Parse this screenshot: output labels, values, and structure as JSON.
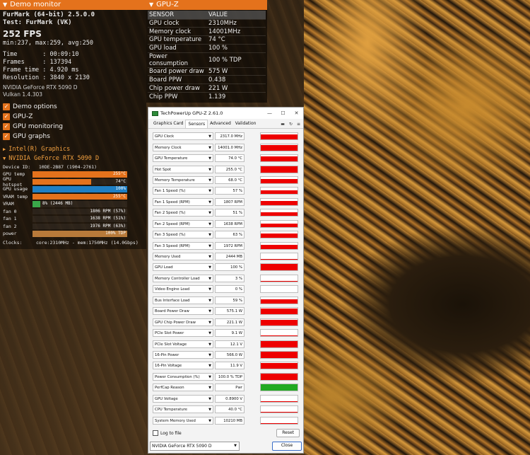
{
  "demo_monitor": {
    "header": "Demo monitor",
    "app": "FurMark (64-bit) 2.5.0.0",
    "test": "Test: FurMark (VK)",
    "fps": "252 FPS",
    "fps_stats": "min:237, max:259, avg:250",
    "time": "Time       : 00:09:10",
    "frames": "Frames     : 137394",
    "frame_time": "Frame time : 4.920 ms",
    "resolution": "Resolution : 3840 x 2130",
    "gpu_name": "NVIDIA GeForce RTX 5090 D",
    "vulkan": "Vulkan 1.4.303",
    "options": [
      "Demo options",
      "GPU-Z",
      "GPU monitoring",
      "GPU graphs"
    ],
    "sections": [
      "Intel(R) Graphics",
      "NVIDIA GeForce RTX 5090 D"
    ],
    "device_id": "Device ID:   10DE-2B87 (1904-2761)",
    "bars": [
      {
        "label": "GPU temp",
        "value": "255°C",
        "fill": 1.0,
        "color": "#e4721c"
      },
      {
        "label": "GPU hotspot",
        "value": "74°C",
        "fill": 0.62,
        "color": "#e4721c"
      },
      {
        "label": "GPU usage",
        "value": "100%",
        "fill": 1.0,
        "color": "#1f7fc4"
      },
      {
        "label": "VRAM temp",
        "value": "255°C",
        "fill": 1.0,
        "color": "#e4721c"
      },
      {
        "label": "VRAM",
        "value": "8% (2446 MB)",
        "fill": 0.08,
        "color": "#3aa84a"
      },
      {
        "label": "fan 0",
        "value": "1806 RPM (57%)",
        "fill": 0.0,
        "color": "#888888"
      },
      {
        "label": "fan 1",
        "value": "1638 RPM (51%)",
        "fill": 0.0,
        "color": "#888888"
      },
      {
        "label": "fan 2",
        "value": "1976 RPM (63%)",
        "fill": 0.0,
        "color": "#888888"
      },
      {
        "label": "power",
        "value": "100% TDP",
        "fill": 1.0,
        "color": "#b87a3a"
      }
    ],
    "clocks": "Clocks:     core:2310MHz - mem:1750MHz (14.0Gbps)"
  },
  "gpuz_overlay": {
    "header": "GPU-Z",
    "col_sensor": "SENSOR",
    "col_value": "VALUE",
    "rows": [
      [
        "GPU clock",
        "2310MHz"
      ],
      [
        "Memory clock",
        "14001MHz"
      ],
      [
        "GPU temperature",
        "74 °C"
      ],
      [
        "GPU load",
        "100 %"
      ],
      [
        "Power consumption",
        "100 % TDP"
      ],
      [
        "Board power draw",
        "575 W"
      ],
      [
        "Board PPW",
        "0.438"
      ],
      [
        "Chip power draw",
        "221 W"
      ],
      [
        "Chip PPW",
        "1.139"
      ]
    ]
  },
  "gpuz_window": {
    "title": "TechPowerUp GPU-Z 2.61.0",
    "min_icon": "—",
    "max_icon": "☐",
    "close_icon": "✕",
    "tabs": [
      "Graphics Card",
      "Sensors",
      "Advanced",
      "Validation"
    ],
    "active_tab": "Sensors",
    "sensors": [
      {
        "name": "GPU Clock",
        "value": "2317.0 MHz",
        "graph": 0.75,
        "color": "#ee0000"
      },
      {
        "name": "Memory Clock",
        "value": "14001.0 MHz",
        "graph": 0.85,
        "color": "#ee0000"
      },
      {
        "name": "GPU Temperature",
        "value": "74.0 °C",
        "graph": 0.75,
        "color": "#ee0000"
      },
      {
        "name": "Hot Spot",
        "value": "255.0 °C",
        "graph": 1.0,
        "color": "#ee0000"
      },
      {
        "name": "Memory Temperature",
        "value": "68.0 °C",
        "graph": 0.7,
        "color": "#ee0000"
      },
      {
        "name": "Fan 1 Speed (%)",
        "value": "57 %",
        "graph": 0.6,
        "color": "#ee0000"
      },
      {
        "name": "Fan 1 Speed (RPM)",
        "value": "1807 RPM",
        "graph": 0.6,
        "color": "#ee0000"
      },
      {
        "name": "Fan 2 Speed (%)",
        "value": "51 %",
        "graph": 0.55,
        "color": "#ee0000"
      },
      {
        "name": "Fan 2 Speed (RPM)",
        "value": "1638 RPM",
        "graph": 0.55,
        "color": "#ee0000"
      },
      {
        "name": "Fan 3 Speed (%)",
        "value": "63 %",
        "graph": 0.65,
        "color": "#ee0000"
      },
      {
        "name": "Fan 3 Speed (RPM)",
        "value": "1972 RPM",
        "graph": 0.65,
        "color": "#ee0000"
      },
      {
        "name": "Memory Used",
        "value": "2444 MB",
        "graph": 0.1,
        "color": "#ee0000"
      },
      {
        "name": "GPU Load",
        "value": "100 %",
        "graph": 1.0,
        "color": "#ee0000"
      },
      {
        "name": "Memory Controller Load",
        "value": "3 %",
        "graph": 0.05,
        "color": "#ee0000"
      },
      {
        "name": "Video Engine Load",
        "value": "0 %",
        "graph": 0.0,
        "color": "#ee0000"
      },
      {
        "name": "Bus Interface Load",
        "value": "59 %",
        "graph": 0.6,
        "color": "#ee0000"
      },
      {
        "name": "Board Power Draw",
        "value": "575.1 W",
        "graph": 0.95,
        "color": "#ee0000"
      },
      {
        "name": "GPU Chip Power Draw",
        "value": "221.1 W",
        "graph": 0.9,
        "color": "#ee0000"
      },
      {
        "name": "PCIe Slot Power",
        "value": "9.1 W",
        "graph": 0.08,
        "color": "#ee0000"
      },
      {
        "name": "PCIe Slot Voltage",
        "value": "12.1 V",
        "graph": 0.9,
        "color": "#ee0000"
      },
      {
        "name": "16-Pin Power",
        "value": "566.0 W",
        "graph": 0.95,
        "color": "#ee0000"
      },
      {
        "name": "16-Pin Voltage",
        "value": "11.9 V",
        "graph": 0.9,
        "color": "#ee0000"
      },
      {
        "name": "Power Consumption (%)",
        "value": "100.0 % TDP",
        "graph": 0.95,
        "color": "#ee0000"
      },
      {
        "name": "PerfCap Reason",
        "value": "Pwr",
        "graph": 1.0,
        "color": "#22aa22"
      },
      {
        "name": "GPU Voltage",
        "value": "0.8900 V",
        "graph": 0.1,
        "color": "#ee0000"
      },
      {
        "name": "CPU Temperature",
        "value": "40.0 °C",
        "graph": 0.1,
        "color": "#ee0000"
      },
      {
        "name": "System Memory Used",
        "value": "10210 MB",
        "graph": 0.12,
        "color": "#ee0000"
      }
    ],
    "log_label": "Log to file",
    "reset_label": "Reset",
    "gpu_select": "NVIDIA GeForce RTX 5090 D",
    "close_label": "Close"
  }
}
